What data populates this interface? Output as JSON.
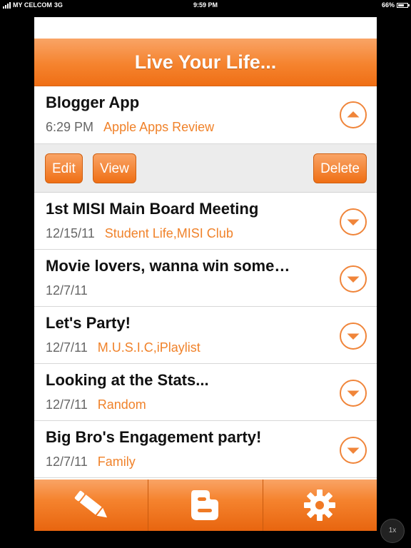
{
  "status_bar": {
    "carrier": "MY CELCOM",
    "network": "3G",
    "time": "9:59 PM",
    "battery": "66%",
    "battery_level": 0.66
  },
  "nav": {
    "title": "Live Your Life..."
  },
  "expanded_post": {
    "title": "Blogger App",
    "date": "6:29 PM",
    "category": "Apple Apps Review",
    "actions": {
      "edit": "Edit",
      "view": "View",
      "delete": "Delete"
    }
  },
  "posts": [
    {
      "title": "1st MISI Main Board Meeting",
      "date": "12/15/11",
      "category": "Student Life,MISI Club"
    },
    {
      "title": "Movie lovers, wanna win some…",
      "date": "12/7/11",
      "category": ""
    },
    {
      "title": "Let's Party!",
      "date": "12/7/11",
      "category": "M.U.S.I.C,iPlaylist"
    },
    {
      "title": "Looking at the Stats...",
      "date": "12/7/11",
      "category": "Random"
    },
    {
      "title": "Big Bro's Engagement party!",
      "date": "12/7/11",
      "category": "Family"
    }
  ],
  "tabbar": {
    "items": [
      {
        "icon": "pencil-icon"
      },
      {
        "icon": "blogger-icon"
      },
      {
        "icon": "gear-icon"
      }
    ]
  },
  "zoom_button": {
    "label": "1x"
  },
  "colors": {
    "accent": "#f5832e",
    "accent_dark": "#e8650f",
    "category_text": "#f0822a"
  }
}
